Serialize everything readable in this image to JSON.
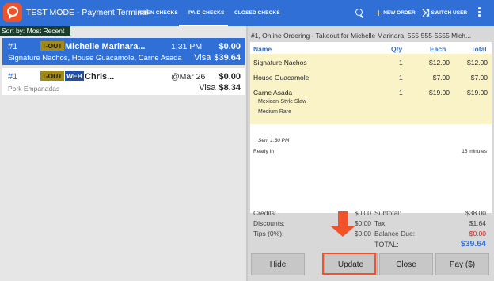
{
  "app": {
    "title": "TEST MODE - Payment Terminal"
  },
  "tabs": {
    "open": "OPEN CHECKS",
    "paid": "PAID CHECKS",
    "closed": "CLOSED CHECKS"
  },
  "toolbar": {
    "new_order": "NEW ORDER",
    "switch_user": "SWITCH USER"
  },
  "sort": {
    "label": "Sort by: Most Recent"
  },
  "checks": [
    {
      "number": "#1",
      "badges": [
        "T-OUT"
      ],
      "name": "Michelle Marinara...",
      "time": "1:31 PM",
      "amount": "$0.00",
      "items": "Signature Nachos, House Guacamole, Carne Asada",
      "pay_method": "Visa",
      "pay_amount": "$39.64"
    },
    {
      "number": "#1",
      "badges": [
        "T-OUT",
        "WEB"
      ],
      "name": "Chris...",
      "time": "@Mar 26",
      "amount": "$0.00",
      "items": "Pork Empanadas",
      "pay_method": "Visa",
      "pay_amount": "$8.34"
    }
  ],
  "order": {
    "header": "#1, Online Ordering - Takeout for Michelle Marinara, 555-555-5555  Mich...",
    "columns": {
      "name": "Name",
      "qty": "Qty",
      "each": "Each",
      "total": "Total"
    },
    "items": [
      {
        "name": "Signature Nachos",
        "qty": "1",
        "each": "$12.00",
        "total": "$12.00",
        "mods": []
      },
      {
        "name": "House Guacamole",
        "qty": "1",
        "each": "$7.00",
        "total": "$7.00",
        "mods": []
      },
      {
        "name": "Carne Asada",
        "qty": "1",
        "each": "$19.00",
        "total": "$19.00",
        "mods": [
          "Mexican-Style Slaw",
          "Medium Rare"
        ]
      }
    ],
    "sent": "Sent 1:30 PM",
    "ready_label": "Ready In",
    "ready_value": "15 minutes"
  },
  "summary": {
    "credits_label": "Credits:",
    "credits_value": "$0.00",
    "discounts_label": "Discounts:",
    "discounts_value": "$0.00",
    "tips_label": "Tips (0%):",
    "tips_value": "$0.00",
    "subtotal_label": "Subtotal:",
    "subtotal_value": "$38.00",
    "tax_label": "Tax:",
    "tax_value": "$1.64",
    "balance_label": "Balance Due:",
    "balance_value": "$0.00",
    "total_label": "TOTAL:",
    "total_value": "$39.64"
  },
  "buttons": {
    "hide": "Hide",
    "update": "Update",
    "close": "Close",
    "pay": "Pay ($)"
  },
  "colors": {
    "accent": "#2f6fd6",
    "highlight": "#f0522a",
    "takeout_badge": "#a38b13",
    "web_badge": "#1f4fa8",
    "items_bg": "#fbf3c8",
    "balance_due": "#d0201a"
  }
}
